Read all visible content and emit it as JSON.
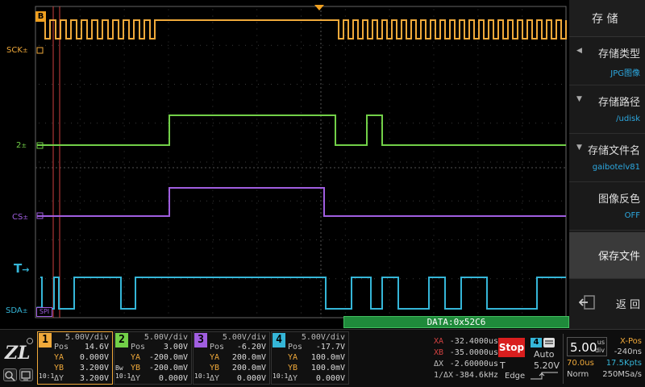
{
  "waveforms": {
    "channels": [
      {
        "id": "sck",
        "label": "SCK",
        "color": "#f0a93a"
      },
      {
        "id": "ch2",
        "label": "2",
        "color": "#72d048"
      },
      {
        "id": "cs",
        "label": "CS",
        "color": "#a05ee0"
      },
      {
        "id": "sda",
        "label": "SDA",
        "color": "#35b6d8"
      }
    ],
    "trigger_marker": "B",
    "trigger_level_marker": "T",
    "decode_tag": "SPI",
    "decode_value": "DATA:0x52C6",
    "colors": {
      "grid": "#3a3a3a",
      "trigger_orange": "#f0a020",
      "cursor_red": "#d04040",
      "decode_green": "#2aa54a"
    }
  },
  "menu": {
    "title": "存 储",
    "items": [
      {
        "label": "存储类型",
        "value": "JPG图像"
      },
      {
        "label": "存储路径",
        "value": "/udisk"
      },
      {
        "label": "存储文件名",
        "value": "gaibotelv81"
      },
      {
        "label": "图像反色",
        "value": "OFF"
      }
    ],
    "save_label": "保存文件",
    "back_label": "返 回"
  },
  "channels": [
    {
      "num": "1",
      "color": "#f0a93a",
      "vdiv": "5.00V/div",
      "pos_key": "Pos",
      "pos": "14.6V",
      "ya_key": "YA",
      "ya": "0.000V",
      "yb_key": "YB",
      "yb": "3.200V",
      "dy_key": "ΔY",
      "dy": "3.200V",
      "side1": "10:1"
    },
    {
      "num": "2",
      "color": "#72d048",
      "vdiv": "5.00V/div",
      "pos_key": "Pos",
      "pos": "3.00V",
      "ya_key": "YA",
      "ya": "-200.0mV",
      "yb_key": "YB",
      "yb": "-200.0mV",
      "dy_key": "ΔY",
      "dy": "0.000V",
      "side1": "10:1",
      "side0": "Bw"
    },
    {
      "num": "3",
      "color": "#a05ee0",
      "vdiv": "5.00V/div",
      "pos_key": "Pos",
      "pos": "-6.20V",
      "ya_key": "YA",
      "ya": "200.0mV",
      "yb_key": "YB",
      "yb": "200.0mV",
      "dy_key": "ΔY",
      "dy": "0.000V",
      "side1": "10:1"
    },
    {
      "num": "4",
      "color": "#35b6d8",
      "vdiv": "5.00V/div",
      "pos_key": "Pos",
      "pos": "-17.7V",
      "ya_key": "YA",
      "ya": "100.0mV",
      "yb_key": "YB",
      "yb": "100.0mV",
      "dy_key": "ΔY",
      "dy": "0.000V",
      "side1": "10:1"
    }
  ],
  "cursors": {
    "xa_key": "XA",
    "xa": "-32.4000us",
    "xb_key": "XB",
    "xb": "-35.0000us",
    "dx_key": "ΔX",
    "dx": "-2.60000us",
    "inv_dx_key": "1/ΔX",
    "inv_dx": "-384.6kHz"
  },
  "run_state": "Stop",
  "trigger": {
    "source": "4",
    "mode": "Auto",
    "t_key": "T",
    "level": "5.20V",
    "type": "Edge"
  },
  "timebase": {
    "value": "5.00",
    "unit_top": "us",
    "unit_bottom": "div",
    "xpos_label": "X-Pos",
    "xpos": "-240ns",
    "delay": "70.0us",
    "points": "17.5Kpts",
    "mode": "Norm",
    "rate": "250MSa/s"
  }
}
